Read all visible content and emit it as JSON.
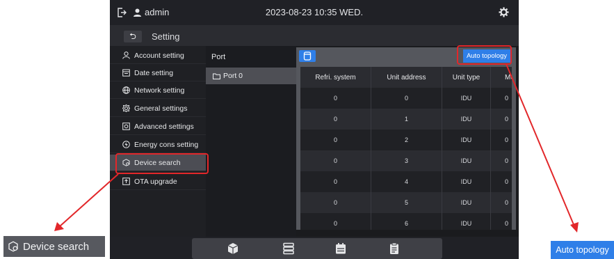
{
  "topbar": {
    "user": "admin",
    "datetime": "2023-08-23 10:35 WED."
  },
  "header": {
    "back_label": "⮌",
    "title": "Setting"
  },
  "sidebar": {
    "items": [
      {
        "label": "Account setting"
      },
      {
        "label": "Date setting"
      },
      {
        "label": "Network setting"
      },
      {
        "label": "General settings"
      },
      {
        "label": "Advanced settings"
      },
      {
        "label": "Energy cons setting"
      },
      {
        "label": "Device search"
      },
      {
        "label": "OTA upgrade"
      }
    ],
    "active_index": 6
  },
  "ports": {
    "header": "Port",
    "items": [
      {
        "label": "Port 0"
      }
    ]
  },
  "toolbar": {
    "auto_topology_label": "Auto topology"
  },
  "table": {
    "columns": [
      "Refri. system",
      "Unit address",
      "Unit type",
      "Mod"
    ],
    "rows": [
      [
        "0",
        "0",
        "IDU",
        "0"
      ],
      [
        "0",
        "1",
        "IDU",
        "0"
      ],
      [
        "0",
        "2",
        "IDU",
        "0"
      ],
      [
        "0",
        "3",
        "IDU",
        "0"
      ],
      [
        "0",
        "4",
        "IDU",
        "0"
      ],
      [
        "0",
        "5",
        "IDU",
        "0"
      ],
      [
        "0",
        "6",
        "IDU",
        "0"
      ]
    ]
  },
  "callouts": {
    "device_search": "Device search",
    "auto_topology": "Auto topology"
  },
  "colors": {
    "accent": "#2f7fe8",
    "highlight": "#e2272a",
    "active_item": "#4c4d54"
  }
}
